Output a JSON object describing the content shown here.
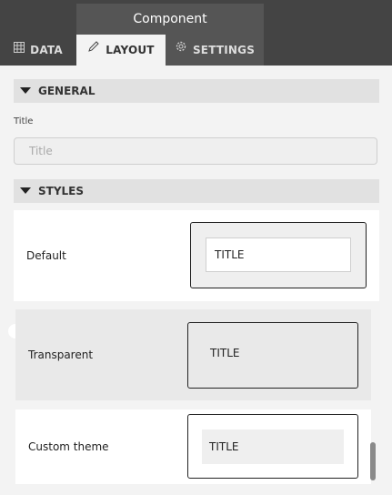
{
  "header": {
    "title": "Component",
    "tabs": [
      {
        "label": "DATA",
        "icon": "grid-icon",
        "active": false
      },
      {
        "label": "LAYOUT",
        "icon": "pencil-icon",
        "active": true
      },
      {
        "label": "SETTINGS",
        "icon": "gear-icon",
        "active": false
      }
    ]
  },
  "general": {
    "section_label": "GENERAL",
    "title_field": {
      "label": "Title",
      "value": "",
      "placeholder": "Title"
    }
  },
  "styles": {
    "section_label": "STYLES",
    "options": [
      {
        "label": "Default",
        "preview_text": "TITLE"
      },
      {
        "label": "Transparent",
        "preview_text": "TITLE"
      },
      {
        "label": "Custom theme",
        "preview_text": "TITLE"
      }
    ]
  },
  "colors": {
    "header_bg": "#444444",
    "active_tab_bg": "#f3f3f3",
    "panel_bg": "#f3f3f3",
    "section_bg": "#e1e1e1"
  }
}
